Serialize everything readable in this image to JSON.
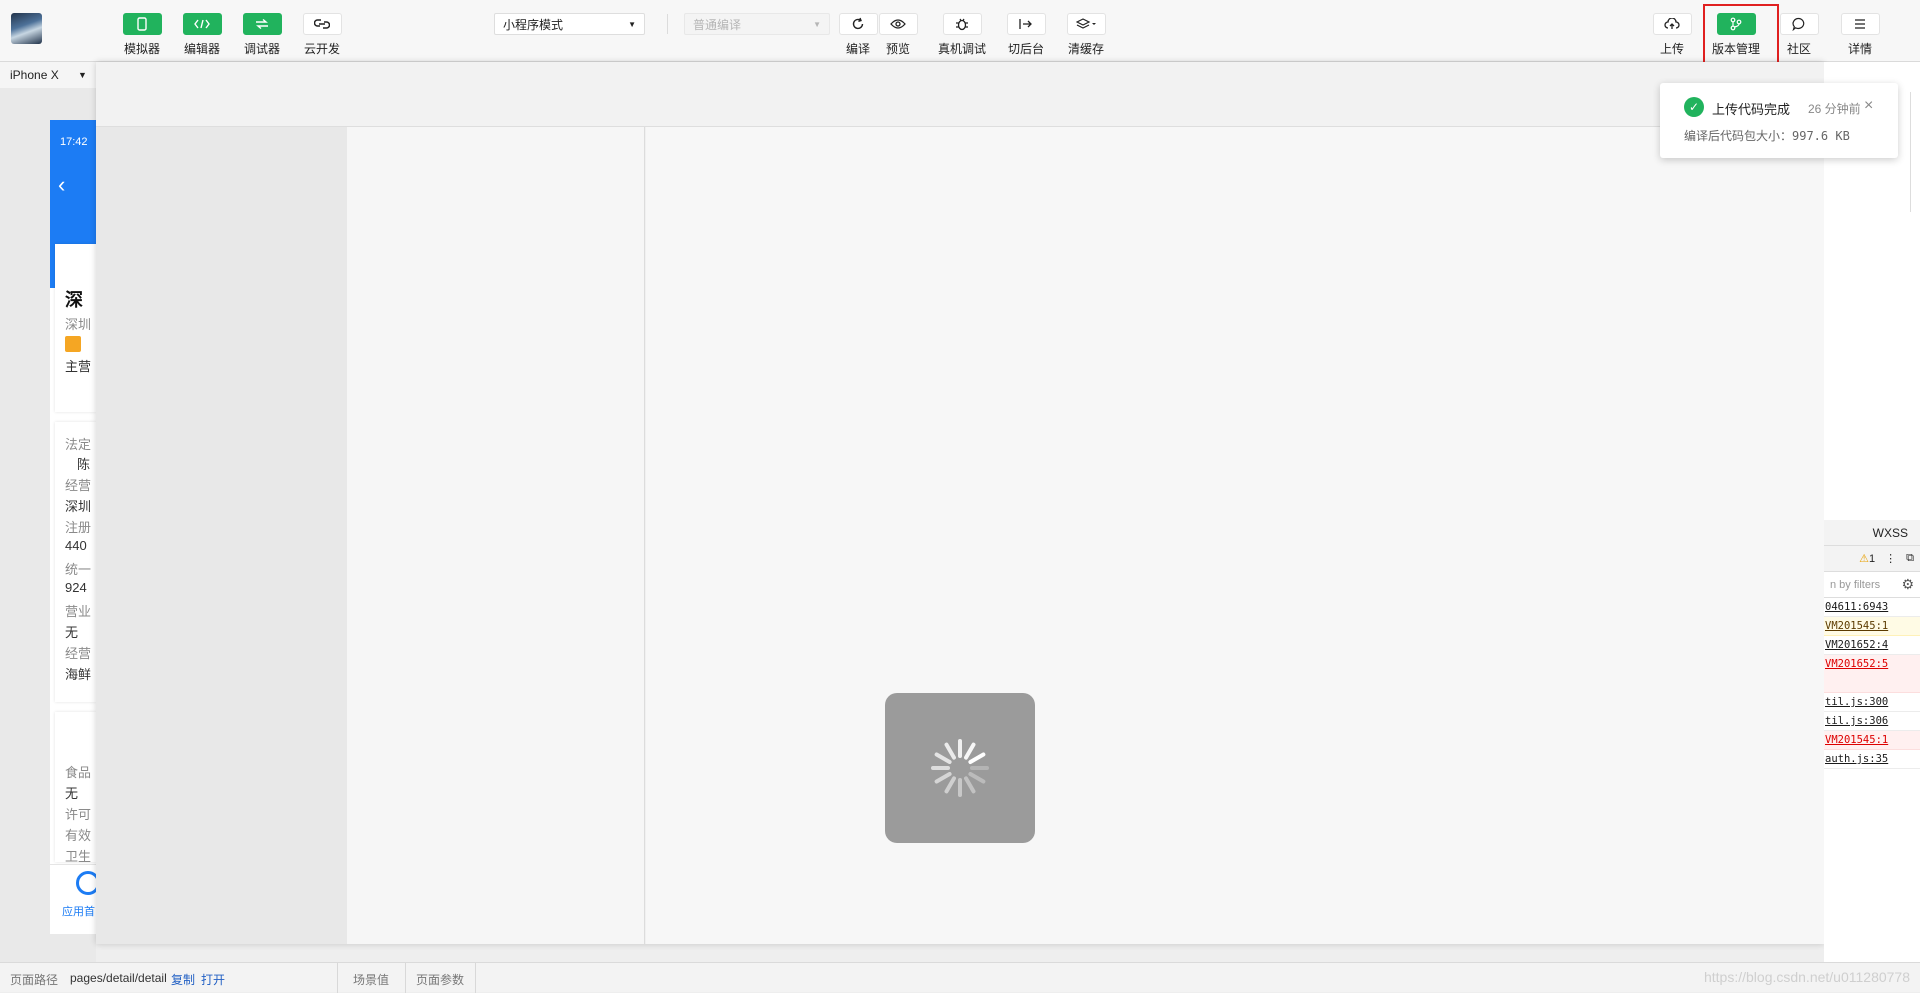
{
  "toolbar": {
    "left_buttons": [
      "模拟器",
      "编辑器",
      "调试器",
      "云开发"
    ],
    "mode_select": "小程序模式",
    "compile_select": "普通编译",
    "center_buttons": [
      "编译",
      "预览",
      "真机调试",
      "切后台",
      "清缓存"
    ],
    "right_buttons": [
      "上传",
      "版本管理",
      "社区",
      "详情"
    ],
    "accent_color": "#21b35d",
    "highlight_color": "#e02020"
  },
  "simulator": {
    "device": "iPhone X",
    "time": "17:42",
    "lines": [
      "深",
      "深圳",
      "主营",
      "法定",
      "陈",
      "经营",
      "深圳",
      "注册",
      "440",
      "统一",
      "924",
      "营业",
      "无",
      "经营",
      "海鲜",
      "食品",
      "无",
      "许可",
      "有效",
      "卫生"
    ],
    "bottom_tab": "应用首"
  },
  "notification": {
    "title": "上传代码完成",
    "time": "26 分钟前",
    "detail": "编译后代码包大小：997.6 KB"
  },
  "devtools": {
    "tab": "WXSS",
    "warn_count": "1",
    "filter_placeholder": "n by filters",
    "logs": [
      "04611:6943",
      "VM201545:1",
      "VM201652:4",
      "VM201652:5",
      "",
      "til.js:300",
      "til.js:306",
      "VM201545:1",
      "auth.js:35"
    ]
  },
  "statusbar": {
    "path_label": "页面路径",
    "path": "pages/detail/detail",
    "copy": "复制",
    "open": "打开",
    "scene": "场景值",
    "params": "页面参数",
    "watermark": "https://blog.csdn.net/u011280778"
  }
}
